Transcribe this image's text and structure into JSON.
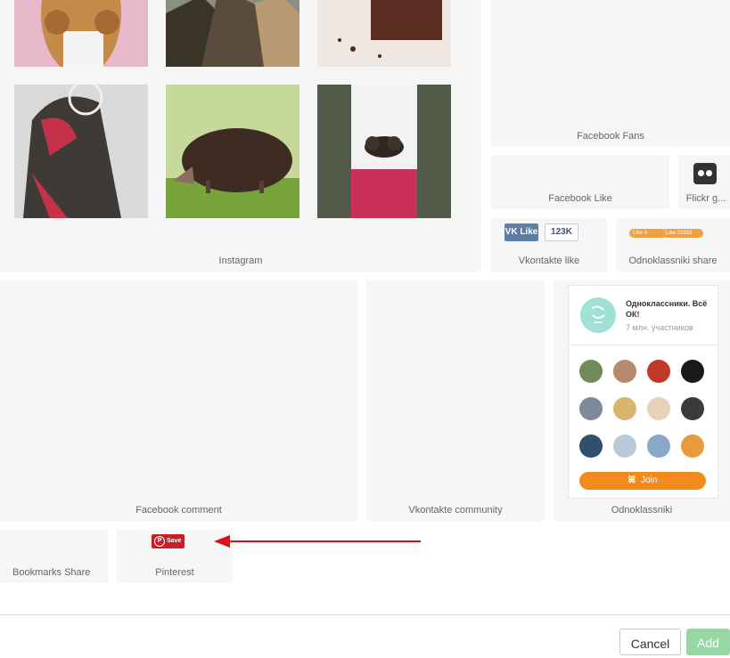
{
  "instagram": {
    "label": "Instagram",
    "photos": [
      "curly-hair-photo",
      "rock-cliffs-photo",
      "chocolate-dessert-photo",
      "face-paint-photo",
      "hedgehog-photo",
      "pinecones-hands-photo"
    ]
  },
  "facebook_fans": {
    "label": "Facebook Fans"
  },
  "facebook_like": {
    "label": "Facebook Like"
  },
  "flickr": {
    "label": "Flickr g..."
  },
  "vkontakte_like": {
    "label": "Vkontakte like",
    "button": "VK Like",
    "count": "123K"
  },
  "odnoklassniki_share": {
    "label": "Odnoklassniki share",
    "pill1": "Like 0",
    "pill2": "Like 21593"
  },
  "facebook_comment": {
    "label": "Facebook comment"
  },
  "vkontakte_community": {
    "label": "Vkontakte community"
  },
  "odnoklassniki": {
    "label": "Odnoklassniki",
    "title": "Одноклассники. Всё ОК!",
    "members": "7 млн. участников",
    "join": "Join",
    "avatar_colors": [
      "#6f8b5a",
      "#b58a6e",
      "#c0392b",
      "#1a1a1a",
      "#7c8a9a",
      "#d8b66b",
      "#e8d2b8",
      "#3b3b3b",
      "#2f4f6f",
      "#b9c9d9",
      "#8aa8c8",
      "#e89a3c"
    ]
  },
  "bookmarks_share": {
    "label": "Bookmarks Share"
  },
  "pinterest": {
    "label": "Pinterest",
    "button": "Save"
  },
  "footer": {
    "cancel": "Cancel",
    "add": "Add"
  },
  "colors": {
    "tile_bg": "#f6f6f6",
    "arrow": "#e0101a",
    "ok_orange": "#f38b1c",
    "add_green": "#97d6a5",
    "pinterest_red": "#cb1f27"
  }
}
